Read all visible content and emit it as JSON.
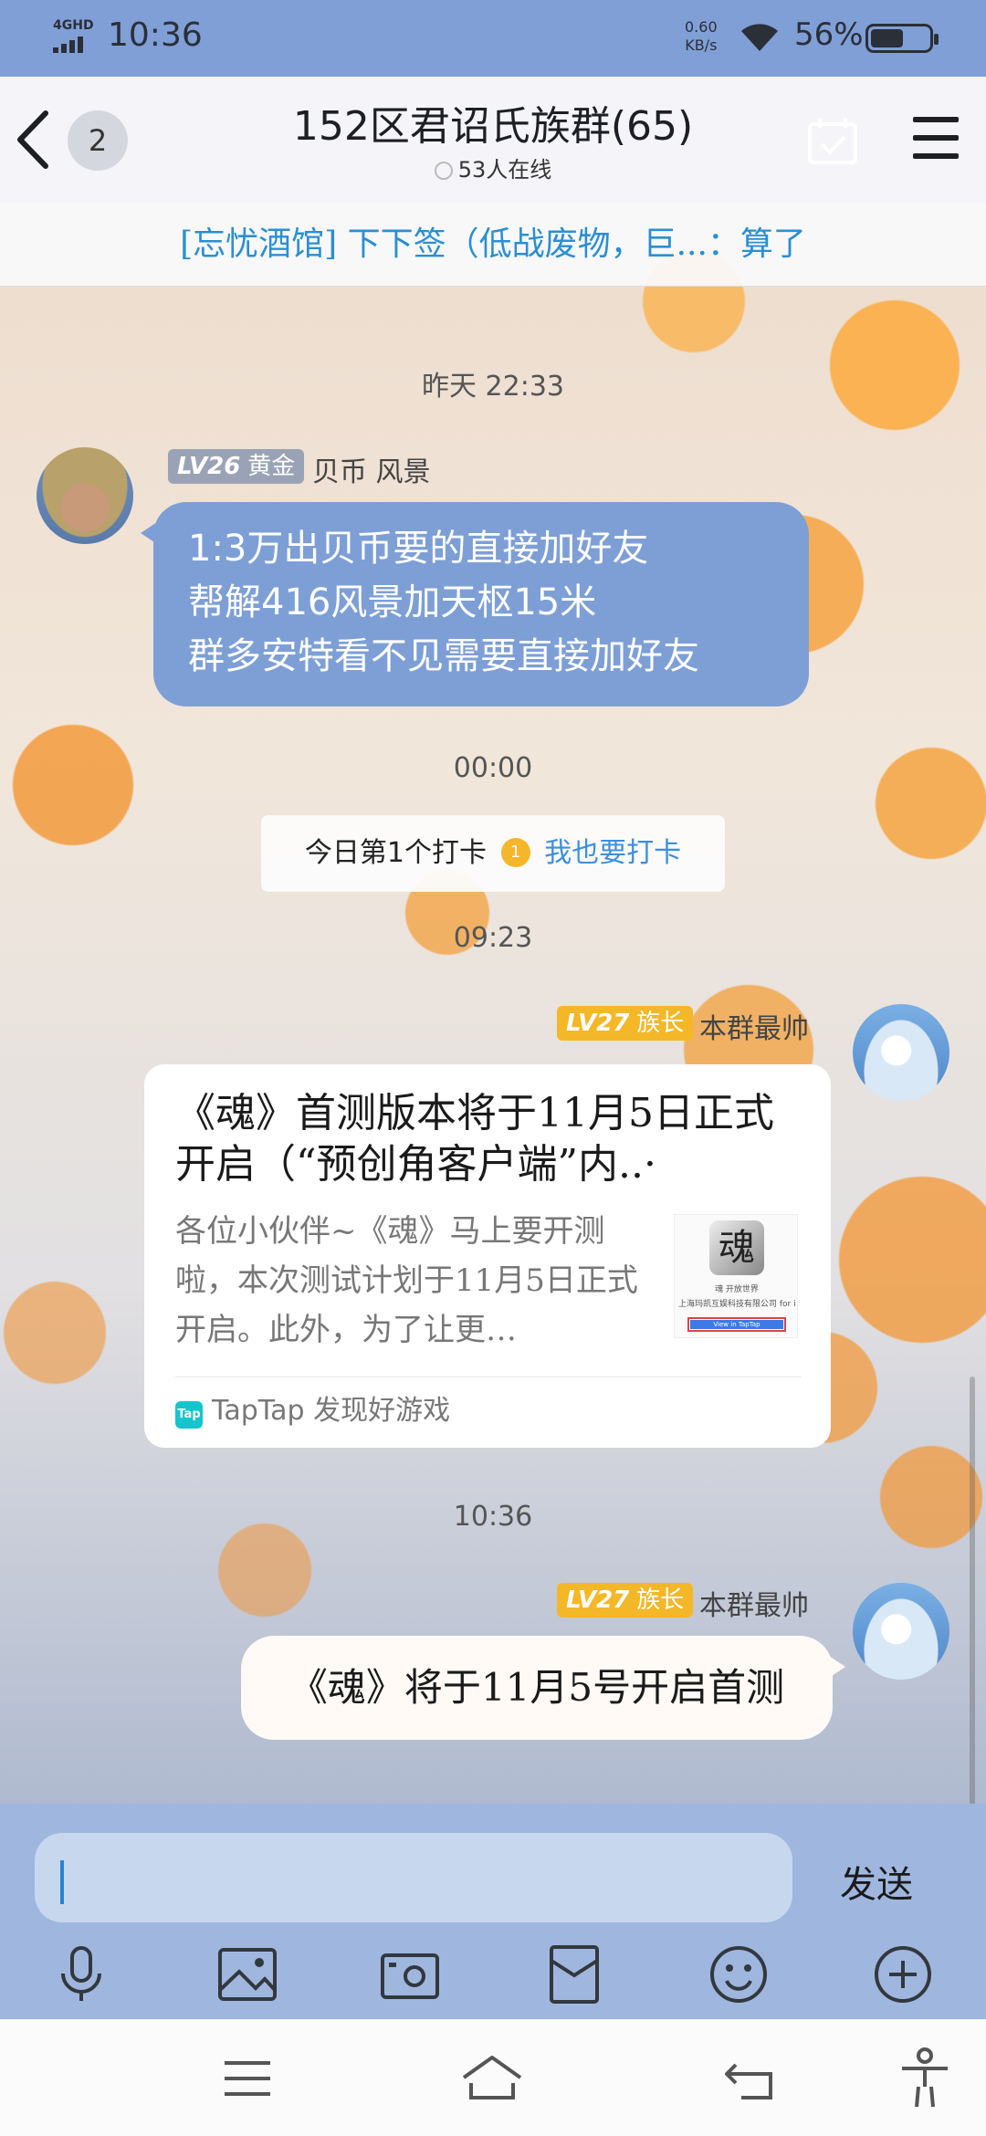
{
  "status_bar": {
    "network": "4GHD",
    "time": "10:36",
    "speed_value": "0.60",
    "speed_unit": "KB/s",
    "battery_percent": "56%",
    "battery_level": 0.56
  },
  "header": {
    "back_icon": "chevron-left-icon",
    "unread_count": "2",
    "title": "152区君诏氏族群(65)",
    "online_text": "53人在线",
    "checkin_icon": "calendar-check-icon",
    "menu_icon": "hamburger-icon"
  },
  "announcement": "[忘忧酒馆] 下下签（低战废物，巨...：算了",
  "messages": [
    {
      "timestamp": "昨天 22:33",
      "level": "LV26",
      "title": "黄金",
      "sender": "贝币 风景",
      "lines": [
        "1:3万出贝币要的直接加好友",
        "帮解416风景加天枢15米",
        "群多安特看不见需要直接加好友"
      ]
    },
    {
      "timestamp": "00:00",
      "checkin_text": "今日第1个打卡",
      "checkin_rank": "1",
      "checkin_link": "我也要打卡"
    },
    {
      "timestamp": "09:23",
      "level": "LV27",
      "title": "族长",
      "sender": "本群最帅",
      "card": {
        "title": "《魂》首测版本将于11月5日正式开启（“预创角客户端”内..·",
        "description": "各位小伙伴~《魂》马上要开测啦，本次测试计划于11月5日正式开启。此外，为了让更…",
        "thumb_logo": "魂",
        "thumb_line1": "魂 开放世界",
        "thumb_line2": "上海玛凯互娱科技有限公司 for it",
        "thumb_button": "View in TapTap",
        "source_icon": "Tap",
        "source": "TapTap 发现好游戏"
      }
    },
    {
      "timestamp": "10:36",
      "level": "LV27",
      "title": "族长",
      "sender": "本群最帅",
      "text": "《魂》将于11月5号开启首测"
    }
  ],
  "input": {
    "placeholder": "",
    "send_label": "发送"
  },
  "toolbar": [
    "microphone-icon",
    "image-icon",
    "camera-icon",
    "red-packet-icon",
    "emoji-icon",
    "plus-icon"
  ],
  "navigation": [
    "menu-icon",
    "home-icon",
    "back-icon",
    "accessibility-icon"
  ],
  "colors": {
    "status_bar": "#7f9fd6",
    "blue_bubble": "#7d9fd6",
    "link": "#3b8fe0",
    "announcement": "#2a8fd3",
    "level_gray": "#9aa3b5",
    "level_gold": "#f4b728",
    "input_bar": "#9fb7de"
  }
}
